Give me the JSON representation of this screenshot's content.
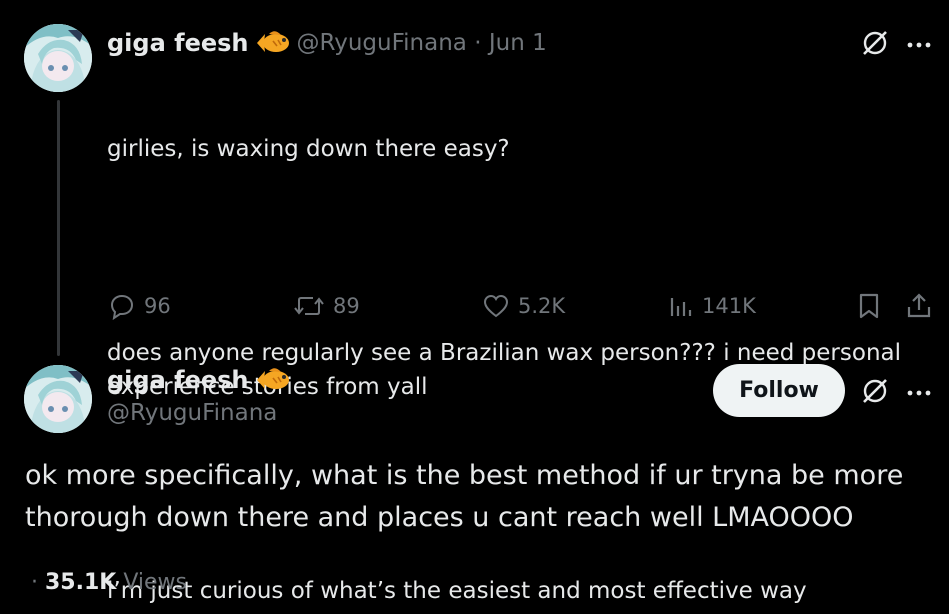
{
  "first_tweet": {
    "display_name": "giga feesh",
    "handle": "@RyuguFinana",
    "separator": "·",
    "date": "Jun 1",
    "paragraphs": [
      "girlies, is waxing down there easy?",
      "does anyone regularly see a Brazilian wax person??? i need personal experience stories from yall",
      "i’m just curious of what’s the easiest and most effective way"
    ],
    "actions": {
      "replies": "96",
      "reposts": "89",
      "likes": "5.2K",
      "views": "141K"
    }
  },
  "main_tweet": {
    "display_name": "giga feesh",
    "handle": "@RyuguFinana",
    "follow_label": "Follow",
    "text": "ok more specifically, what is the best method if ur tryna be more thorough down there and places u cant reach well LMAOOOO",
    "view_prefix": "·",
    "view_count": "35.1K",
    "view_label": "Views"
  },
  "icons": {
    "fish": "fish-emoji-icon",
    "grok": "grok-icon",
    "more": "more-icon",
    "reply": "reply-icon",
    "repost": "repost-icon",
    "like": "like-icon",
    "views": "views-icon",
    "bookmark": "bookmark-icon",
    "share": "share-icon"
  },
  "colors": {
    "background": "#000000",
    "text": "#e7e9ea",
    "muted": "#71767b",
    "follow_bg": "#eff3f4",
    "fish": "#f5a623"
  }
}
